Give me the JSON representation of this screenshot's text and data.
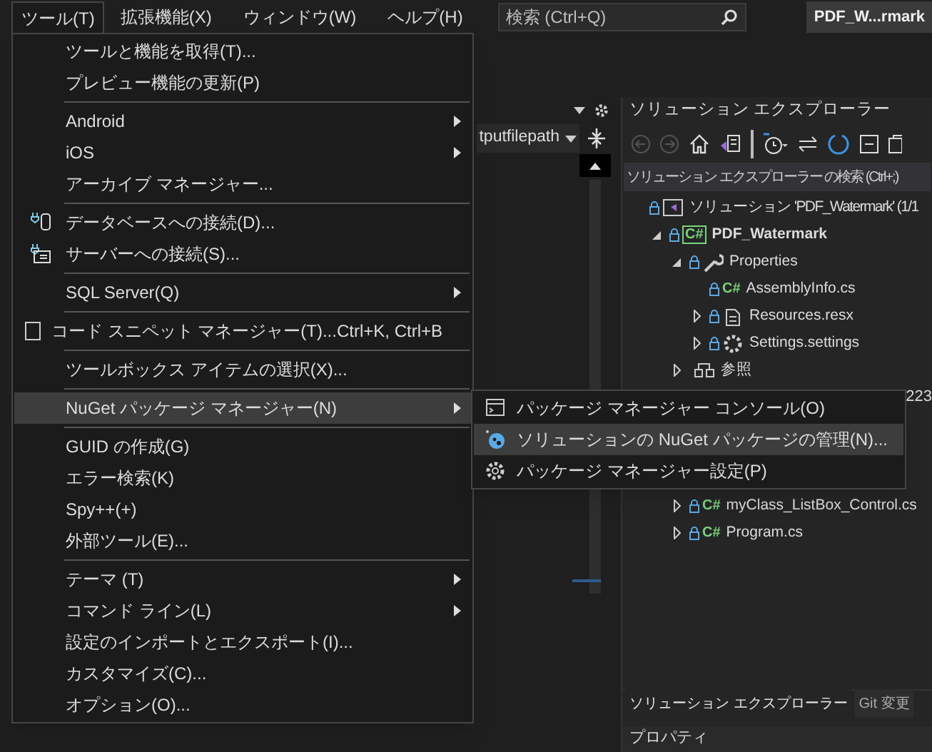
{
  "menubar": {
    "menus": [
      {
        "label": "ツール(T)",
        "selected": true
      },
      {
        "label": "拡張機能(X)",
        "selected": false
      },
      {
        "label": "ウィンドウ(W)",
        "selected": false
      },
      {
        "label": "ヘルプ(H)",
        "selected": false
      }
    ],
    "search": {
      "placeholder": "検索 (Ctrl+Q)"
    },
    "solution_button": "PDF_W...rmark"
  },
  "editor": {
    "dropdown": "tputfilepath"
  },
  "tools_menu": [
    {
      "kind": "command",
      "label": "ツールと機能を取得(T)...",
      "selected": false
    },
    {
      "kind": "command",
      "label": "プレビュー機能の更新(P)",
      "selected": false
    },
    {
      "kind": "separator"
    },
    {
      "kind": "submenu",
      "label": "Android",
      "selected": false
    },
    {
      "kind": "submenu",
      "label": "iOS",
      "selected": false
    },
    {
      "kind": "command",
      "label": "アーカイブ マネージャー...",
      "selected": false
    },
    {
      "kind": "separator"
    },
    {
      "kind": "command",
      "label": "データベースへの接続(D)...",
      "selected": false
    },
    {
      "kind": "command",
      "label": "サーバーへの接続(S)...",
      "selected": false
    },
    {
      "kind": "separator"
    },
    {
      "kind": "submenu",
      "label": "SQL Server(Q)",
      "selected": false
    },
    {
      "kind": "separator"
    },
    {
      "kind": "command",
      "label": "コード スニペット マネージャー(T)...",
      "shortcut": "Ctrl+K, Ctrl+B",
      "selected": false
    },
    {
      "kind": "separator"
    },
    {
      "kind": "command",
      "label": "ツールボックス アイテムの選択(X)...",
      "selected": false
    },
    {
      "kind": "separator"
    },
    {
      "kind": "submenu",
      "label": "NuGet パッケージ マネージャー(N)",
      "selected": true
    },
    {
      "kind": "separator"
    },
    {
      "kind": "command",
      "label": "GUID の作成(G)",
      "selected": false
    },
    {
      "kind": "command",
      "label": "エラー検索(K)",
      "selected": false
    },
    {
      "kind": "command",
      "label": "Spy++(+)",
      "selected": false
    },
    {
      "kind": "command",
      "label": "外部ツール(E)...",
      "selected": false
    },
    {
      "kind": "separator"
    },
    {
      "kind": "submenu",
      "label": "テーマ (T)",
      "selected": false
    },
    {
      "kind": "submenu",
      "label": "コマンド ライン(L)",
      "selected": false
    },
    {
      "kind": "command",
      "label": "設定のインポートとエクスポート(I)...",
      "selected": false
    },
    {
      "kind": "command",
      "label": "カスタマイズ(C)...",
      "selected": false
    },
    {
      "kind": "command",
      "label": "オプション(O)...",
      "selected": false
    }
  ],
  "nuget_submenu": [
    {
      "label": "パッケージ マネージャー コンソール(O)",
      "selected": false
    },
    {
      "label": "ソリューションの NuGet パッケージの管理(N)...",
      "selected": true
    },
    {
      "label": "パッケージ マネージャー設定(P)",
      "selected": false
    }
  ],
  "solution_explorer": {
    "title": "ソリューション エクスプローラー",
    "search": {
      "placeholder": "ソリューション エクスプローラー の検索 (Ctrl+;)"
    },
    "tree": [
      {
        "kind": "solution",
        "label": "ソリューション 'PDF_Watermark' (1/1",
        "children": [
          {
            "kind": "project",
            "label": "PDF_Watermark",
            "badge": "C#",
            "expanded": true,
            "children": [
              {
                "kind": "folder",
                "label": "Properties",
                "expanded": true,
                "children": [
                  {
                    "kind": "file",
                    "label": "AssemblyInfo.cs",
                    "badge": "C#"
                  },
                  {
                    "kind": "resource",
                    "label": "Resources.resx",
                    "expanded": false
                  },
                  {
                    "kind": "settings",
                    "label": "Settings.settings",
                    "expanded": false
                  }
                ]
              },
              {
                "kind": "references",
                "label": "参照",
                "expanded": false
              },
              {
                "kind": "covered",
                "label": "223"
              },
              {
                "kind": "file",
                "label": "myClass_ListBox_Control.cs",
                "badge": "C#",
                "expanded": false
              },
              {
                "kind": "file",
                "label": "Program.cs",
                "badge": "C#",
                "expanded": false
              }
            ]
          }
        ]
      }
    ],
    "tabs": [
      {
        "label": "ソリューション エクスプローラー",
        "selected": true
      },
      {
        "label": "Git 変更",
        "selected": false
      }
    ],
    "properties_title": "プロパティ"
  }
}
